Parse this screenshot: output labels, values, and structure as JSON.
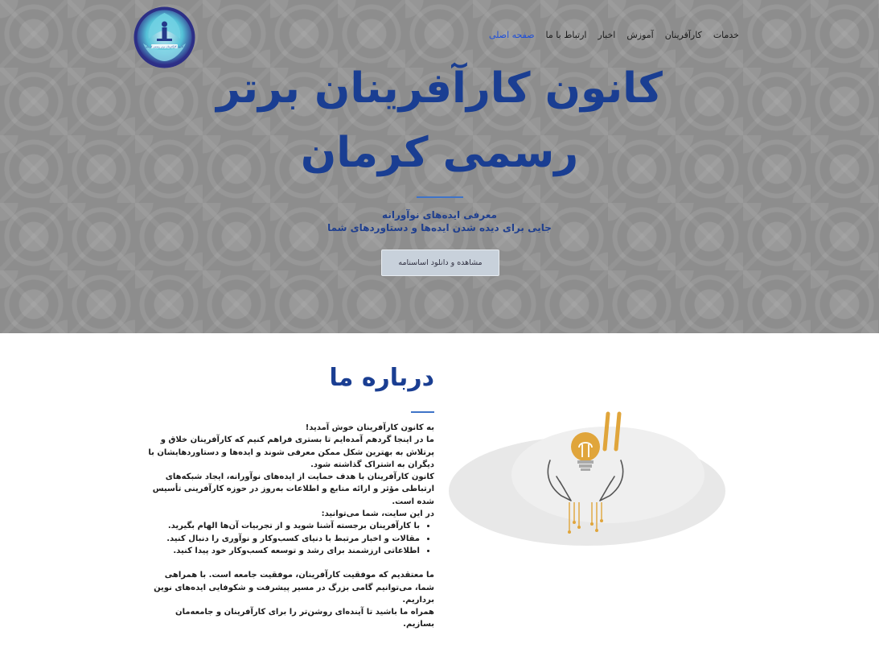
{
  "nav": {
    "items": [
      "صفحه اصلی",
      "ارتباط با ما",
      "اخبار",
      "آموزش",
      "کارآفرینان",
      "خدمات"
    ],
    "active_index": 0
  },
  "logo": {
    "text": "کانون کارآفرینان برتر رسمی کرمان"
  },
  "hero": {
    "title_line1": "کانون کارآفرینان برتر",
    "title_line2": "رسمی کرمان",
    "tagline1": "معرفی ایده‌های نوآورانه",
    "tagline2": "جایی برای دیده شدن ایده‌ها و دستاوردهای شما",
    "cta_label": "مشاهده و دانلود اساسنامه"
  },
  "about": {
    "title": "درباره ما",
    "welcome": "به کانون کارآفرینان خوش آمدید!",
    "p1": "ما در اینجا گردهم آمده‌ایم تا بستری فراهم کنیم که کارآفرینان خلاق و پرتلاش به بهترین شکل ممکن معرفی شوند و ایده‌ها و دستاوردهایشان با دیگران به اشتراک گذاشته شود.",
    "p2": "کانون کارآفرینان با هدف حمایت از ایده‌های نوآورانه، ایجاد شبکه‌های ارتباطی مؤثر و ارائه منابع و اطلاعات به‌روز در حوزه کارآفرینی تأسیس شده است.",
    "list_intro": "در این سایت، شما می‌توانید:",
    "list": [
      "با کارآفرینان برجسته آشنا شوید و از تجربیات آن‌ها الهام بگیرید.",
      "مقالات و اخبار مرتبط با دنیای کسب‌وکار و نوآوری را دنبال کنید.",
      "اطلاعاتی ارزشمند برای رشد و توسعه کسب‌وکار خود پیدا کنید."
    ],
    "p3": "ما معتقدیم که موفقیت کارآفرینان، موفقیت جامعه است. با همراهی شما، می‌توانیم گامی بزرگ در مسیر پیشرفت و شکوفایی ایده‌های نوین برداریم.",
    "p4": "همراه ما باشید تا آینده‌ای روشن‌تر را برای کارآفرینان و جامعه‌مان بسازیم."
  },
  "colors": {
    "brand_blue": "#1a3e92",
    "nav_active": "#1f4fd8",
    "accent_gold": "#e0a53b"
  }
}
